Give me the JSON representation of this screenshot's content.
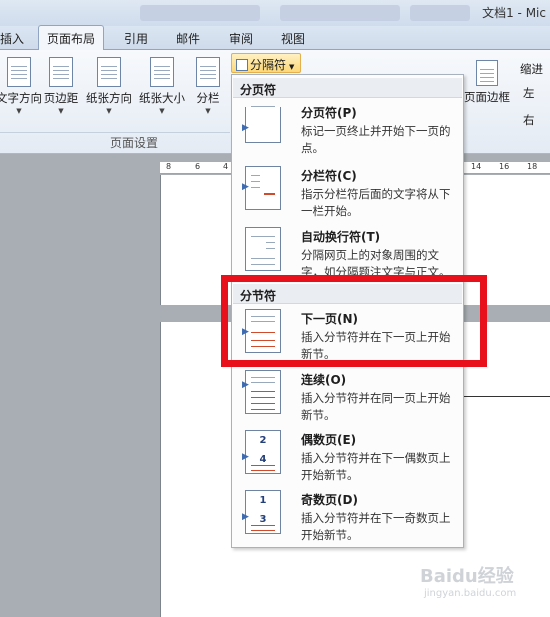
{
  "window": {
    "title": "文档1 - Mic"
  },
  "tabs": [
    "插入",
    "页面布局",
    "引用",
    "邮件",
    "审阅",
    "视图"
  ],
  "ribbon": {
    "buttons": [
      "文字方向",
      "页边距",
      "纸张方向",
      "纸张大小",
      "分栏"
    ],
    "group_label": "页面设置",
    "page_border": "页面边框",
    "indent_label": "缩进",
    "left_label": "左",
    "right_label": "右"
  },
  "breaks_button": {
    "label": "分隔符"
  },
  "ruler_ticks": [
    "8",
    "6",
    "4",
    "14",
    "16",
    "18"
  ],
  "menu": {
    "page_breaks_header": "分页符",
    "section_breaks_header": "分节符",
    "items": [
      {
        "title": "分页符(P)",
        "description": "标记一页终止并开始下一页的点。"
      },
      {
        "title": "分栏符(C)",
        "description": "指示分栏符后面的文字将从下一栏开始。"
      },
      {
        "title": "自动换行符(T)",
        "description": "分隔网页上的对象周围的文字，如分隔题注文字与正文。"
      },
      {
        "title": "下一页(N)",
        "description": "插入分节符并在下一页上开始新节。"
      },
      {
        "title": "连续(O)",
        "description": "插入分节符并在同一页上开始新节。"
      },
      {
        "title": "偶数页(E)",
        "description": "插入分节符并在下一偶数页上开始新节。"
      },
      {
        "title": "奇数页(D)",
        "description": "插入分节符并在下一奇数页上开始新节。"
      }
    ]
  },
  "watermark": {
    "text": "Baidu经验",
    "url_text": "jingyan.baidu.com"
  },
  "colors": {
    "highlight": "#e8101a",
    "active_button": "#fcd877"
  }
}
